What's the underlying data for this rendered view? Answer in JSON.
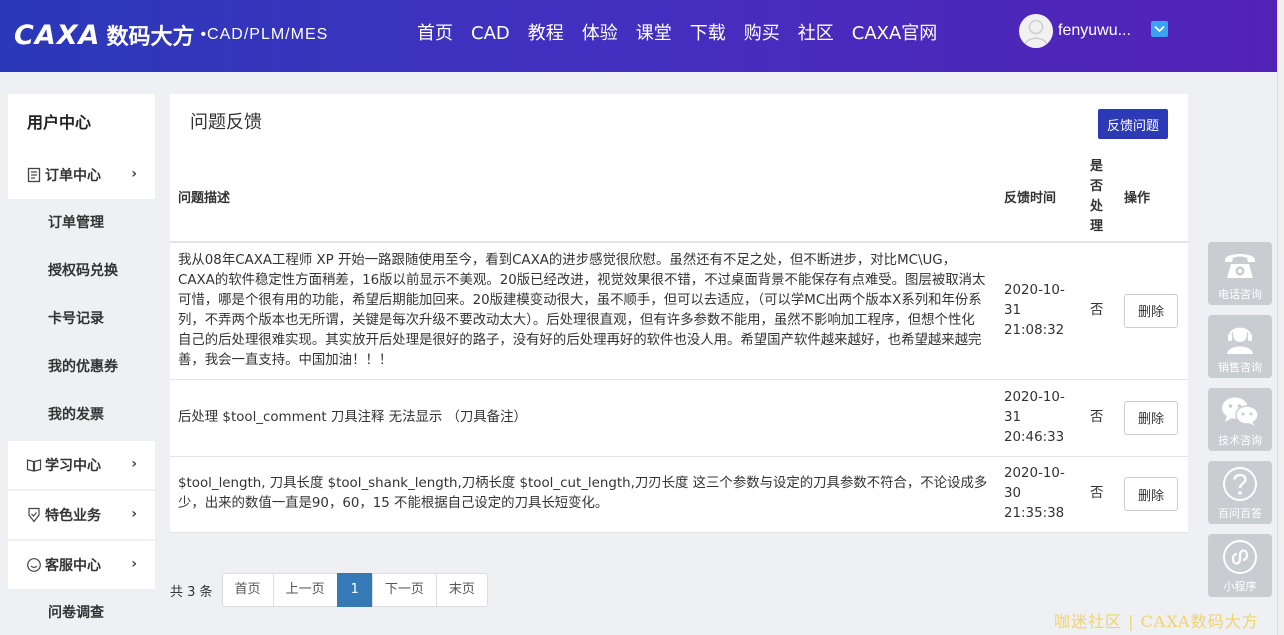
{
  "header": {
    "logo_en": "CAXA",
    "logo_cn": "数码大方",
    "logo_sub": "•CAD/PLM/MES",
    "nav": [
      "首页",
      "CAD",
      "教程",
      "体验",
      "课堂",
      "下载",
      "购买",
      "社区",
      "CAXA官网"
    ],
    "user_name": "fenyuwu..."
  },
  "sidebar": {
    "title": "用户中心",
    "groups": [
      {
        "label": "订单中心",
        "icon": "order-list-icon",
        "subs": [
          "订单管理",
          "授权码兑换",
          "卡号记录",
          "我的优惠券",
          "我的发票"
        ]
      },
      {
        "label": "学习中心",
        "icon": "book-icon",
        "subs": []
      },
      {
        "label": "特色业务",
        "icon": "medal-icon",
        "subs": []
      },
      {
        "label": "客服中心",
        "icon": "service-icon",
        "subs": [
          "问卷调查"
        ]
      }
    ],
    "chevron": "›"
  },
  "main": {
    "title": "问题反馈",
    "feedback_button": "反馈问题",
    "columns": {
      "desc": "问题描述",
      "time": "反馈时间",
      "handled": "是否处理",
      "op": "操作"
    },
    "rows": [
      {
        "desc": "我从08年CAXA工程师 XP 开始一路跟随使用至今，看到CAXA的进步感觉很欣慰。虽然还有不足之处，但不断进步，对比MC\\UG，CAXA的软件稳定性方面稍差，16版以前显示不美观。20版已经改进，视觉效果很不错，不过桌面背景不能保存有点难受。图层被取消太可惜，哪是个很有用的功能，希望后期能加回来。20版建模变动很大，虽不顺手，但可以去适应，（可以学MC出两个版本X系列和年份系列，不弄两个版本也无所谓，关键是每次升级不要改动太大）。后处理很直观，但有许多参数不能用，虽然不影响加工程序，但想个性化自己的后处理很难实现。其实放开后处理是很好的路子，没有好的后处理再好的软件也没人用。希望国产软件越来越好，也希望越来越完善，我会一直支持。中国加油！！！",
        "date": "2020-10-31",
        "time": "21:08:32",
        "handled": "否",
        "op": "删除"
      },
      {
        "desc": "后处理 $tool_comment 刀具注释 无法显示 （刀具备注）",
        "date": "2020-10-31",
        "time": "20:46:33",
        "handled": "否",
        "op": "删除"
      },
      {
        "desc": "$tool_length, 刀具长度 $tool_shank_length,刀柄长度 $tool_cut_length,刀刃长度 这三个参数与设定的刀具参数不符合，不论设成多少，出来的数值一直是90，60，15 不能根据自己设定的刀具长短变化。",
        "date": "2020-10-30",
        "time": "21:35:38",
        "handled": "否",
        "op": "删除"
      }
    ]
  },
  "pager": {
    "total": "共 3 条",
    "first": "首页",
    "prev": "上一页",
    "current": "1",
    "next": "下一页",
    "last": "末页"
  },
  "tools": [
    {
      "label": "电话咨询",
      "icon": "phone-icon"
    },
    {
      "label": "销售咨询",
      "icon": "headset-icon"
    },
    {
      "label": "技术咨询",
      "icon": "wechat-icon"
    },
    {
      "label": "百问百答",
      "icon": "question-icon"
    },
    {
      "label": "小程序",
      "icon": "mini-program-icon"
    }
  ],
  "watermark": "咖迷社区 | CAXA数码大方",
  "colors": {
    "header_start": "#2a39b8",
    "header_end": "#5322b6",
    "button": "#2c3ab8",
    "pager_active": "#337ab7",
    "tool_bg": "#c9ccd1"
  }
}
